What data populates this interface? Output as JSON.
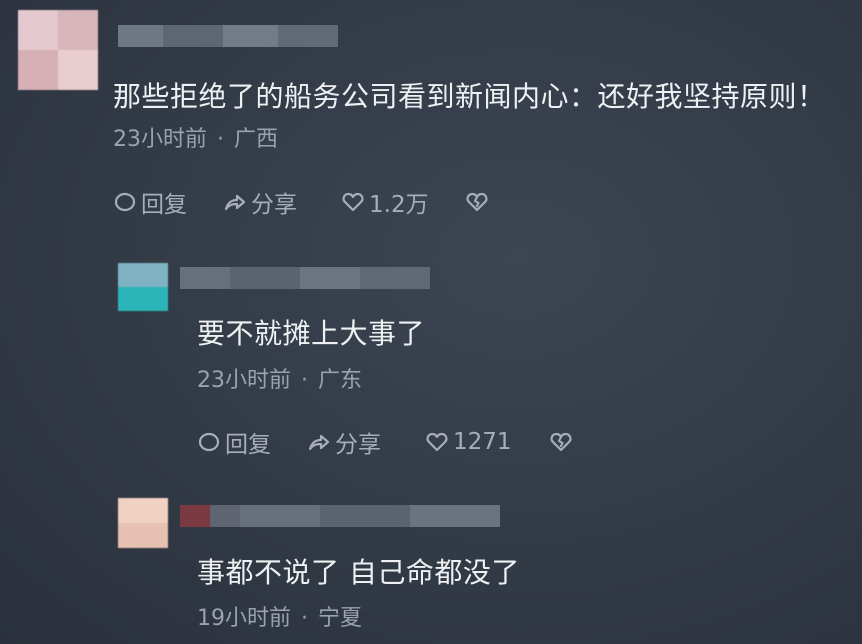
{
  "comments": [
    {
      "text": "那些拒绝了的船务公司看到新闻内心：还好我坚持原则！",
      "time": "23小时前",
      "location": "广西",
      "reply_label": "回复",
      "share_label": "分享",
      "likes": "1.2万"
    },
    {
      "text": "要不就摊上大事了",
      "time": "23小时前",
      "location": "广东",
      "reply_label": "回复",
      "share_label": "分享",
      "likes": "1271"
    },
    {
      "text": "事都不说了 自己命都没了",
      "time": "19小时前",
      "location": "宁夏"
    }
  ],
  "meta_separator": "·",
  "icons": {
    "reply": "reply-bubble-icon",
    "share": "share-arrow-icon",
    "like": "heart-icon",
    "dislike": "broken-heart-icon"
  },
  "colors": {
    "background": "#343c48",
    "text": "#eef0f2",
    "meta": "#9aa3ad",
    "action": "#a7aeb7"
  }
}
